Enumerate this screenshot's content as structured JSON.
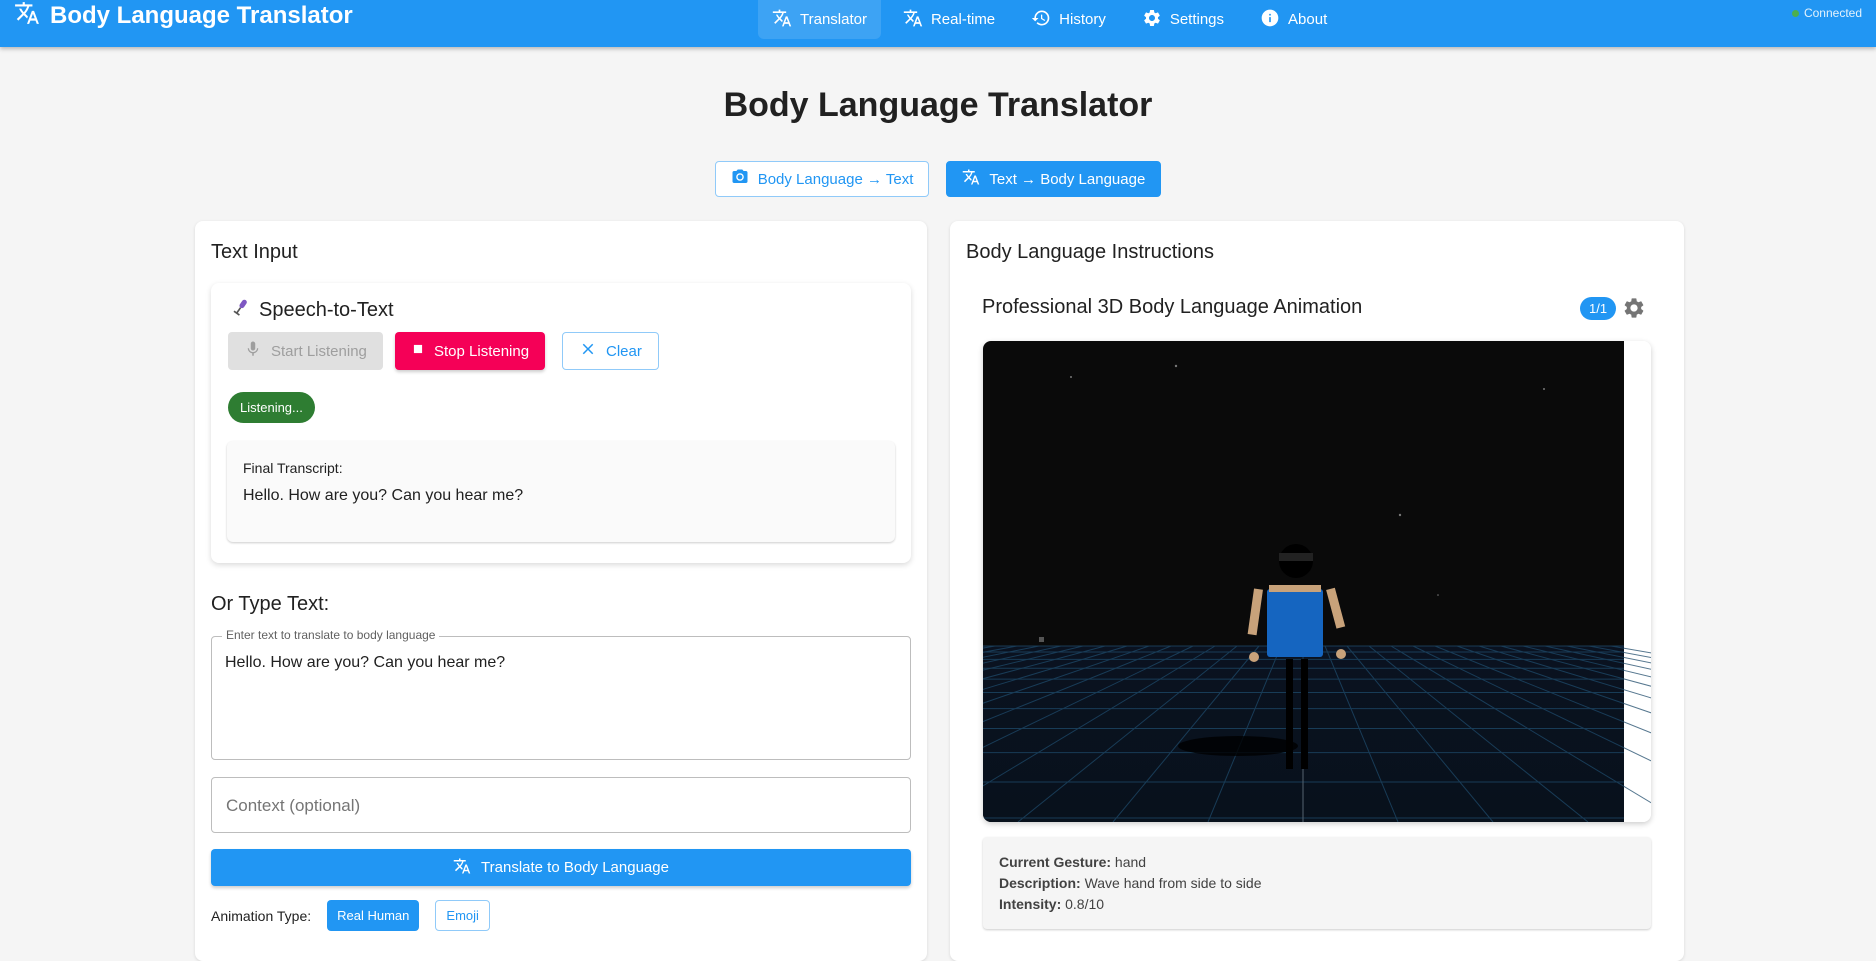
{
  "app": {
    "title": "Body Language Translator",
    "connection_status": "Connected"
  },
  "nav": {
    "items": [
      {
        "label": "Translator",
        "icon": "translate-icon",
        "active": true
      },
      {
        "label": "Real-time",
        "icon": "translate-icon"
      },
      {
        "label": "History",
        "icon": "history-icon"
      },
      {
        "label": "Settings",
        "icon": "gear-icon"
      },
      {
        "label": "About",
        "icon": "info-icon"
      }
    ]
  },
  "page": {
    "title": "Body Language Translator"
  },
  "mode": {
    "body_to_text": "Body Language → Text",
    "text_to_body": "Text → Body Language",
    "selected": "Text → Body Language"
  },
  "left_panel": {
    "title": "Text Input",
    "stt": {
      "title": "Speech-to-Text",
      "start_label": "Start Listening",
      "stop_label": "Stop Listening",
      "clear_label": "Clear",
      "status": "Listening...",
      "transcript_label": "Final Transcript:",
      "transcript_text": "Hello. How are you? Can you hear me?"
    },
    "or_type_label": "Or Type Text:",
    "text_field_label": "Enter text to translate to body language",
    "text_field_value": "Hello. How are you? Can you hear me?",
    "context_placeholder": "Context (optional)",
    "translate_label": "Translate to Body Language",
    "animation_type_label": "Animation Type:",
    "animation_options": [
      "Real Human",
      "Emoji"
    ],
    "animation_selected": "Real Human"
  },
  "right_panel": {
    "title": "Body Language Instructions",
    "animation_title": "Professional 3D Body Language Animation",
    "count_badge": "1/1",
    "gesture": {
      "current_label": "Current Gesture:",
      "current_value": "hand",
      "description_label": "Description:",
      "description_value": "Wave hand from side to side",
      "intensity_label": "Intensity:",
      "intensity_value": "0.8/10"
    }
  },
  "colors": {
    "primary": "#2196f3",
    "stop": "#f50057",
    "listening": "#2e7d32",
    "scene_bg": "#0a0a0a",
    "grid": "#1e4a6a",
    "avatar_shirt": "#1565c0",
    "avatar_skin": "#c8a27a"
  }
}
